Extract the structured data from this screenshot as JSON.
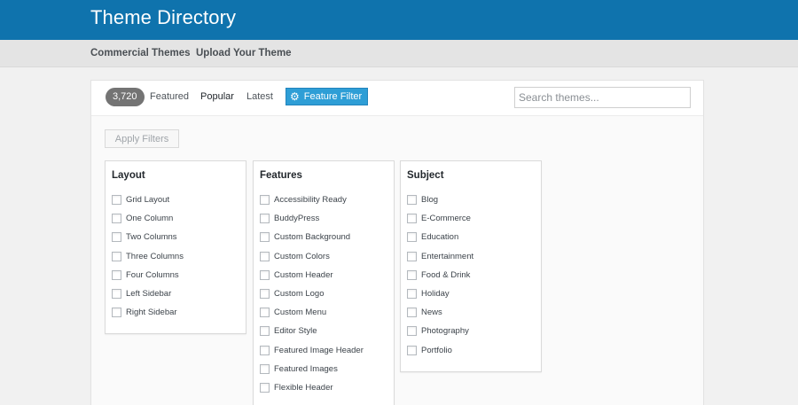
{
  "header": {
    "title": "Theme Directory"
  },
  "subnav": {
    "items": [
      "Commercial Themes",
      "Upload Your Theme"
    ]
  },
  "toolbar": {
    "count": "3,720",
    "links": [
      "Featured",
      "Popular",
      "Latest"
    ],
    "feature_filter": "Feature Filter",
    "search_placeholder": "Search themes..."
  },
  "apply_label": "Apply Filters",
  "groups": [
    {
      "title": "Layout",
      "options": [
        "Grid Layout",
        "One Column",
        "Two Columns",
        "Three Columns",
        "Four Columns",
        "Left Sidebar",
        "Right Sidebar"
      ]
    },
    {
      "title": "Features",
      "options": [
        "Accessibility Ready",
        "BuddyPress",
        "Custom Background",
        "Custom Colors",
        "Custom Header",
        "Custom Logo",
        "Custom Menu",
        "Editor Style",
        "Featured Image Header",
        "Featured Images",
        "Flexible Header"
      ]
    },
    {
      "title": "Subject",
      "options": [
        "Blog",
        "E-Commerce",
        "Education",
        "Entertainment",
        "Food & Drink",
        "Holiday",
        "News",
        "Photography",
        "Portfolio"
      ]
    }
  ]
}
